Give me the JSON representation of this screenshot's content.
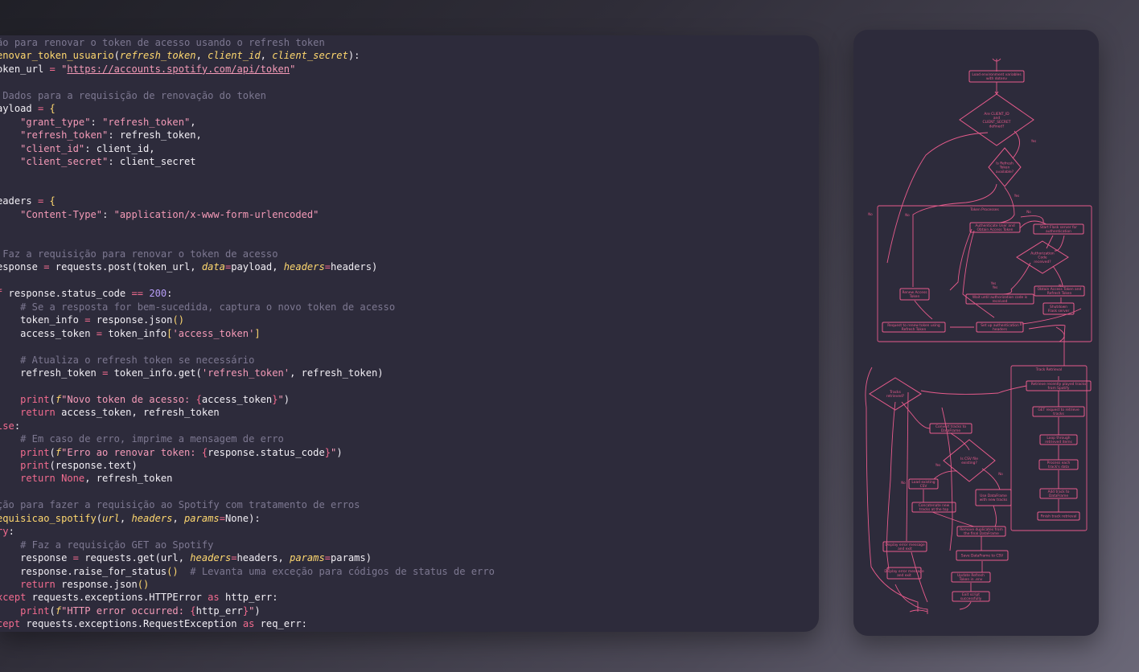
{
  "code": {
    "lines": [
      [
        [
          "c",
          "ão para renovar o token de acesso usando o refresh token"
        ]
      ],
      [
        [
          "f",
          "enovar_token_usuario"
        ],
        [
          "t",
          "("
        ],
        [
          "p",
          "refresh_token"
        ],
        [
          "t",
          ", "
        ],
        [
          "p",
          "client_id"
        ],
        [
          "t",
          ", "
        ],
        [
          "p",
          "client_secret"
        ],
        [
          "t",
          "):"
        ]
      ],
      [
        [
          "t",
          "oken_url "
        ],
        [
          "k",
          "="
        ],
        [
          "t",
          " "
        ],
        [
          "s",
          "\""
        ],
        [
          "su",
          "https://accounts.spotify.com/api/token"
        ],
        [
          "s",
          "\""
        ]
      ],
      [],
      [
        [
          "c",
          " Dados para a requisição de renovação do token"
        ]
      ],
      [
        [
          "t",
          "ayload "
        ],
        [
          "k",
          "="
        ],
        [
          "t",
          " "
        ],
        [
          "f",
          "{"
        ]
      ],
      [
        [
          "t",
          "    "
        ],
        [
          "s",
          "\"grant_type\""
        ],
        [
          "t",
          ": "
        ],
        [
          "s",
          "\"refresh_token\""
        ],
        [
          "t",
          ","
        ]
      ],
      [
        [
          "t",
          "    "
        ],
        [
          "s",
          "\"refresh_token\""
        ],
        [
          "t",
          ": refresh_token,"
        ]
      ],
      [
        [
          "t",
          "    "
        ],
        [
          "s",
          "\"client_id\""
        ],
        [
          "t",
          ": client_id,"
        ]
      ],
      [
        [
          "t",
          "    "
        ],
        [
          "s",
          "\"client_secret\""
        ],
        [
          "t",
          ": client_secret"
        ]
      ],
      [],
      [],
      [
        [
          "t",
          "eaders "
        ],
        [
          "k",
          "="
        ],
        [
          "t",
          " "
        ],
        [
          "f",
          "{"
        ]
      ],
      [
        [
          "t",
          "    "
        ],
        [
          "s",
          "\"Content-Type\""
        ],
        [
          "t",
          ": "
        ],
        [
          "s",
          "\"application/x-www-form-urlencoded\""
        ]
      ],
      [],
      [],
      [
        [
          "c",
          " Faz a requisição para renovar o token de acesso"
        ]
      ],
      [
        [
          "t",
          "esponse "
        ],
        [
          "k",
          "="
        ],
        [
          "t",
          " requests.post(token_url, "
        ],
        [
          "p",
          "data"
        ],
        [
          "k",
          "="
        ],
        [
          "t",
          "payload, "
        ],
        [
          "p",
          "headers"
        ],
        [
          "k",
          "="
        ],
        [
          "t",
          "headers)"
        ]
      ],
      [],
      [
        [
          "k",
          "f"
        ],
        [
          "t",
          " response.status_code "
        ],
        [
          "k",
          "=="
        ],
        [
          "t",
          " "
        ],
        [
          "n",
          "200"
        ],
        [
          "t",
          ":"
        ]
      ],
      [
        [
          "t",
          "    "
        ],
        [
          "c",
          "# Se a resposta for bem-sucedida, captura o novo token de acesso"
        ]
      ],
      [
        [
          "t",
          "    token_info "
        ],
        [
          "k",
          "="
        ],
        [
          "t",
          " response.json"
        ],
        [
          "f",
          "()"
        ]
      ],
      [
        [
          "t",
          "    access_token "
        ],
        [
          "k",
          "="
        ],
        [
          "t",
          " token_info"
        ],
        [
          "f",
          "["
        ],
        [
          "s",
          "'access_token'"
        ],
        [
          "f",
          "]"
        ]
      ],
      [],
      [
        [
          "t",
          "    "
        ],
        [
          "c",
          "# Atualiza o refresh token se necessário"
        ]
      ],
      [
        [
          "t",
          "    refresh_token "
        ],
        [
          "k",
          "="
        ],
        [
          "t",
          " token_info.get("
        ],
        [
          "s",
          "'refresh_token'"
        ],
        [
          "t",
          ", refresh_token)"
        ]
      ],
      [],
      [
        [
          "t",
          "    "
        ],
        [
          "k",
          "print"
        ],
        [
          "t",
          "("
        ],
        [
          "p",
          "f"
        ],
        [
          "s",
          "\"Novo token de acesso: "
        ],
        [
          "k",
          "{"
        ],
        [
          "t",
          "access_token"
        ],
        [
          "k",
          "}"
        ],
        [
          "s",
          "\""
        ],
        [
          "t",
          ")"
        ]
      ],
      [
        [
          "t",
          "    "
        ],
        [
          "k",
          "return"
        ],
        [
          "t",
          " access_token, refresh_token"
        ]
      ],
      [
        [
          "k",
          "lse"
        ],
        [
          "t",
          ":"
        ]
      ],
      [
        [
          "t",
          "    "
        ],
        [
          "c",
          "# Em caso de erro, imprime a mensagem de erro"
        ]
      ],
      [
        [
          "t",
          "    "
        ],
        [
          "k",
          "print"
        ],
        [
          "t",
          "("
        ],
        [
          "p",
          "f"
        ],
        [
          "s",
          "\"Erro ao renovar token: "
        ],
        [
          "k",
          "{"
        ],
        [
          "t",
          "response.status_code"
        ],
        [
          "k",
          "}"
        ],
        [
          "s",
          "\""
        ],
        [
          "t",
          ")"
        ]
      ],
      [
        [
          "t",
          "    "
        ],
        [
          "k",
          "print"
        ],
        [
          "t",
          "(response.text)"
        ]
      ],
      [
        [
          "t",
          "    "
        ],
        [
          "k",
          "return"
        ],
        [
          "t",
          " "
        ],
        [
          "k",
          "None"
        ],
        [
          "t",
          ", refresh_token"
        ]
      ],
      [],
      [
        [
          "c",
          "ção para fazer a requisição ao Spotify com tratamento de erros"
        ]
      ],
      [
        [
          "f",
          "equisicao_spotify"
        ],
        [
          "t",
          "("
        ],
        [
          "p",
          "url"
        ],
        [
          "t",
          ", "
        ],
        [
          "p",
          "headers"
        ],
        [
          "t",
          ", "
        ],
        [
          "p",
          "params"
        ],
        [
          "k",
          "="
        ],
        [
          "t",
          "None):"
        ]
      ],
      [
        [
          "k",
          "ry"
        ],
        [
          "t",
          ":"
        ]
      ],
      [
        [
          "t",
          "    "
        ],
        [
          "c",
          "# Faz a requisição GET ao Spotify"
        ]
      ],
      [
        [
          "t",
          "    response "
        ],
        [
          "k",
          "="
        ],
        [
          "t",
          " requests.get(url, "
        ],
        [
          "p",
          "headers"
        ],
        [
          "k",
          "="
        ],
        [
          "t",
          "headers, "
        ],
        [
          "p",
          "params"
        ],
        [
          "k",
          "="
        ],
        [
          "t",
          "params)"
        ]
      ],
      [
        [
          "t",
          "    response.raise_for_status"
        ],
        [
          "f",
          "()"
        ],
        [
          "t",
          "  "
        ],
        [
          "c",
          "# Levanta uma exceção para códigos de status de erro"
        ]
      ],
      [
        [
          "t",
          "    "
        ],
        [
          "k",
          "return"
        ],
        [
          "t",
          " response.json"
        ],
        [
          "f",
          "()"
        ]
      ],
      [
        [
          "k",
          "xcept"
        ],
        [
          "t",
          " requests.exceptions.HTTPError "
        ],
        [
          "k",
          "as"
        ],
        [
          "t",
          " http_err:"
        ]
      ],
      [
        [
          "t",
          "    "
        ],
        [
          "k",
          "print"
        ],
        [
          "t",
          "("
        ],
        [
          "p",
          "f"
        ],
        [
          "s",
          "\"HTTP error occurred: "
        ],
        [
          "k",
          "{"
        ],
        [
          "t",
          "http_err"
        ],
        [
          "k",
          "}"
        ],
        [
          "s",
          "\""
        ],
        [
          "t",
          ")"
        ]
      ],
      [
        [
          "k",
          "cept"
        ],
        [
          "t",
          " requests.exceptions.RequestException "
        ],
        [
          "k",
          "as"
        ],
        [
          "t",
          " req_err:"
        ]
      ]
    ]
  },
  "flowchart": {
    "colors": {
      "stroke": "#e75b8c",
      "panel": "#2d2b3b",
      "background": "#4d4a58"
    },
    "subgraphs": [
      {
        "id": "sg1",
        "label": "Token Processes"
      },
      {
        "id": "sg2",
        "label": "Track Retrieval"
      }
    ],
    "nodes": [
      {
        "id": "n1",
        "shape": "rect",
        "lines": [
          "Load environment variables",
          "with dotenv"
        ]
      },
      {
        "id": "n2",
        "shape": "diamond",
        "lines": [
          "Are CLIENT_ID",
          "and",
          "CLIENT_SECRET",
          "defined?"
        ]
      },
      {
        "id": "n3",
        "shape": "diamond",
        "lines": [
          "Is Refresh",
          "Token",
          "available?"
        ]
      },
      {
        "id": "n4",
        "shape": "rect",
        "lines": [
          "Authenticate User and",
          "Obtain Access Token"
        ]
      },
      {
        "id": "n5",
        "shape": "rect",
        "lines": [
          "Start Flask server for",
          "authentication"
        ]
      },
      {
        "id": "n6",
        "shape": "diamond",
        "lines": [
          "Authorization",
          "Code",
          "received?"
        ]
      },
      {
        "id": "n7",
        "shape": "rect",
        "lines": [
          "Renew Access",
          "Token"
        ]
      },
      {
        "id": "n8",
        "shape": "rect",
        "lines": [
          "Wait until authorization code is",
          "received"
        ]
      },
      {
        "id": "n9",
        "shape": "rect",
        "lines": [
          "Obtain Access Token and",
          "Refresh Token"
        ]
      },
      {
        "id": "n10",
        "shape": "rect",
        "lines": [
          "Shutdown",
          "Flask server"
        ]
      },
      {
        "id": "n11",
        "shape": "rect",
        "lines": [
          "Request to renew token using",
          "Refresh Token"
        ]
      },
      {
        "id": "n12",
        "shape": "rect",
        "lines": [
          "Set up authentication",
          "headers"
        ]
      },
      {
        "id": "n13",
        "shape": "rect",
        "lines": [
          "Retrieve recently played tracks",
          "from Spotify"
        ]
      },
      {
        "id": "n14",
        "shape": "rect",
        "lines": [
          "GET request to retrieve",
          "tracks"
        ]
      },
      {
        "id": "n15",
        "shape": "rect",
        "lines": [
          "Loop through",
          "retrieved items"
        ]
      },
      {
        "id": "n16",
        "shape": "rect",
        "lines": [
          "Process each",
          "track's data"
        ]
      },
      {
        "id": "n17",
        "shape": "rect",
        "lines": [
          "Add track to",
          "DataFrame"
        ]
      },
      {
        "id": "n18",
        "shape": "rect",
        "lines": [
          "Finish track retrieval"
        ]
      },
      {
        "id": "n19",
        "shape": "diamond",
        "lines": [
          "Tracks",
          "retrieved?"
        ]
      },
      {
        "id": "n20",
        "shape": "rect",
        "lines": [
          "Convert tracks to",
          "DataFrame"
        ]
      },
      {
        "id": "n21",
        "shape": "diamond",
        "lines": [
          "Is CSV file",
          "existing?"
        ]
      },
      {
        "id": "n22",
        "shape": "rect",
        "lines": [
          "Load existing",
          "CSV"
        ]
      },
      {
        "id": "n23",
        "shape": "rect",
        "lines": [
          "Concatenate new",
          "tracks at the top"
        ]
      },
      {
        "id": "n24",
        "shape": "rect",
        "lines": [
          "Use DataFrame",
          "with new tracks"
        ]
      },
      {
        "id": "n25",
        "shape": "rect",
        "lines": [
          "Remove duplicates from",
          "the final DataFrame"
        ]
      },
      {
        "id": "n26",
        "shape": "rect",
        "lines": [
          "Save DataFrame to CSV"
        ]
      },
      {
        "id": "n27",
        "shape": "rect",
        "lines": [
          "Update Refresh",
          "Token in .env"
        ]
      },
      {
        "id": "n28",
        "shape": "rect",
        "lines": [
          "Exit script",
          "successfully"
        ]
      },
      {
        "id": "n29",
        "shape": "rect",
        "lines": [
          "Display error message",
          "and exit"
        ]
      },
      {
        "id": "n30",
        "shape": "rect",
        "lines": [
          "Display error message",
          "and exit"
        ]
      }
    ],
    "edge_labels": [
      "Yes",
      "No",
      "Yes",
      "No",
      "Yes",
      "No",
      "Yes",
      "No",
      "Yes",
      "No",
      "No"
    ]
  }
}
